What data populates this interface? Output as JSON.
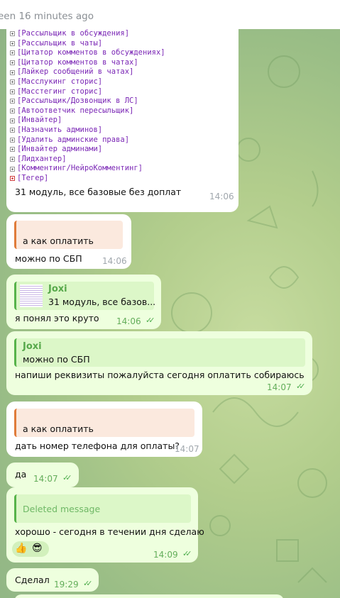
{
  "header": {
    "status": "een 16 minutes ago"
  },
  "messages": {
    "m1": {
      "code_lines": [
        "[Рассыльщик в обсуждения]",
        "[Рассыльщик в чаты]",
        "[Цитатор комментов в обсуждениях]",
        "[Цитатор комментов в чатах]",
        "[Лайкер сообщений в чатах]",
        "[Масслукинг сторис]",
        "[Масстегинг сторис]",
        "[Рассыльщик/Дозвонщик в ЛС]",
        "[Автоответчик пересыльщик]",
        "[Инвайтер]",
        "[Назначить админов]",
        "[Удалить админские права]",
        "[Инвайтер админами]",
        "[Лидхантер]",
        "[Комментинг/НейроКомментинг]",
        "[Тегер]"
      ],
      "text": "31 модуль, все базовые без доплат",
      "time": "14:06"
    },
    "m2": {
      "reply_text": "а как оплатить",
      "text": "можно по СБП",
      "time": "14:06"
    },
    "m3": {
      "reply_name": "Joxi",
      "reply_text": "31 модуль, все базов...",
      "text": "я понял это круто",
      "time": "14:06"
    },
    "m4": {
      "reply_name": "Joxi",
      "reply_text": "можно по СБП",
      "text": "напиши реквизиты пожалуйста сегодня оплатить собираюсь",
      "time": "14:07"
    },
    "m5": {
      "reply_text": "а как оплатить",
      "text": "дать номер телефона для оплаты?",
      "time": "14:07"
    },
    "m6": {
      "text": "да",
      "time": "14:07"
    },
    "m7": {
      "reply_text": "Deleted message",
      "text": "хорошо - сегодня в течении дня сделаю",
      "time": "14:09",
      "reactions": [
        "👍",
        "😎"
      ]
    },
    "m8": {
      "text": "Сделал",
      "time": "19:29"
    }
  },
  "colors": {
    "incoming": "#ffffff",
    "outgoing": "#eeffde",
    "accent": "#56b34a",
    "reply_orange": "#e07b3a",
    "code_text": "#7a26b5"
  },
  "icons": {
    "read_receipt": "double-check-icon",
    "bullet": "tree-plus-icon"
  }
}
